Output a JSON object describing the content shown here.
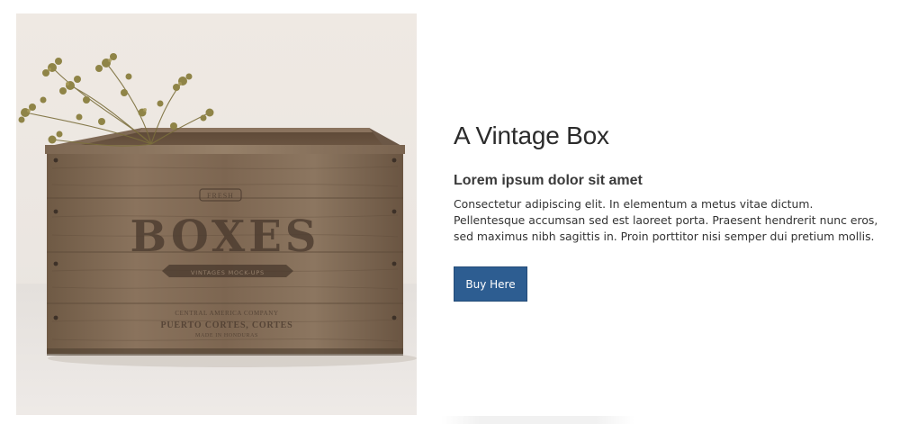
{
  "product": {
    "image_alt": "Wooden crate with dried flowers",
    "crate_print": {
      "top_badge": "FRESH",
      "main_word": "BOXES",
      "ribbon": "VINTAGES MOCK-UPS",
      "line1": "CENTRAL AMERICA COMPANY",
      "line2": "PUERTO CORTES, CORTES",
      "line3": "MADE IN HONDURAS"
    },
    "title": "A Vintage Box",
    "subtitle": "Lorem ipsum dolor sit amet",
    "description": "Consectetur adipiscing elit. In elementum a metus vitae dictum. Pellentesque accumsan sed est laoreet porta. Praesent hendrerit nunc eros, sed maximus nibh sagittis in. Proin porttitor nisi semper dui pretium mollis.",
    "button_label": "Buy Here"
  },
  "colors": {
    "button_bg": "#2d5d91",
    "title_text": "#2b2b2b",
    "body_text": "#333333"
  }
}
